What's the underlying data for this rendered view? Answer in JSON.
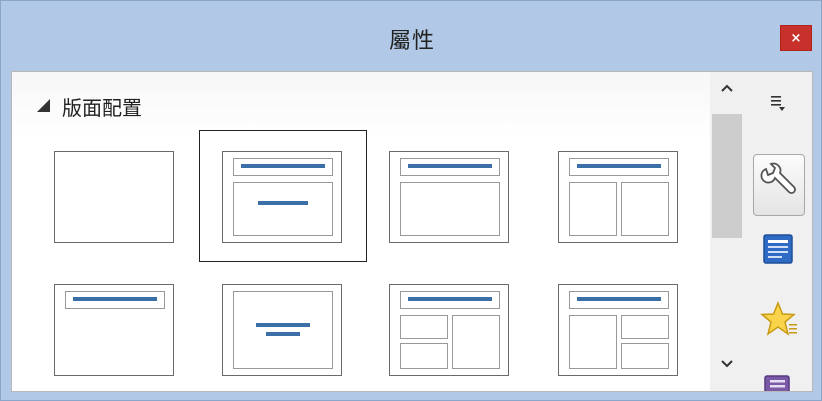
{
  "window": {
    "title": "屬性",
    "close_label": "×"
  },
  "panel": {
    "section_title": "版面配置",
    "layouts": [
      {
        "name": "blank"
      },
      {
        "name": "title-content",
        "selected": true
      },
      {
        "name": "title-and-box"
      },
      {
        "name": "title-two-boxes"
      },
      {
        "name": "title-only"
      },
      {
        "name": "centered-text"
      },
      {
        "name": "title-two-left-one-right"
      },
      {
        "name": "title-one-left-two-right"
      }
    ]
  },
  "scrollbar": {
    "up_glyph": "^",
    "down_glyph": "v"
  },
  "sidebar": {
    "buttons": [
      {
        "name": "sidebar-menu",
        "icon": "menu-dropdown-icon"
      },
      {
        "name": "properties-deck",
        "icon": "wrench-icon",
        "active": true
      },
      {
        "name": "slide-layouts-deck",
        "icon": "slide-layout-icon"
      },
      {
        "name": "gallery-deck",
        "icon": "star-icon"
      },
      {
        "name": "navigator-deck",
        "icon": "navigator-icon"
      }
    ]
  }
}
